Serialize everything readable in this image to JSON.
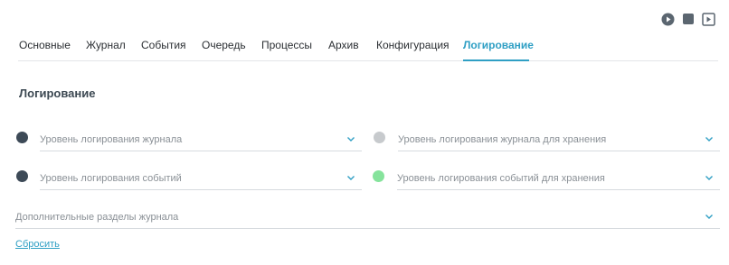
{
  "controls": {
    "play": "play-icon",
    "stop": "stop-icon",
    "step": "step-forward-icon"
  },
  "tabs": [
    {
      "label": "Основные"
    },
    {
      "label": "Журнал"
    },
    {
      "label": "События"
    },
    {
      "label": "Очередь"
    },
    {
      "label": "Процессы"
    },
    {
      "label": "Архив"
    },
    {
      "label": "Конфигурация"
    },
    {
      "label": "Логирование",
      "active": true
    }
  ],
  "section_title": "Логирование",
  "fields": {
    "journal_level": {
      "placeholder": "Уровень логирования журнала",
      "status_color": "#3d4a57"
    },
    "journal_storage_level": {
      "placeholder": "Уровень логирования журнала для хранения",
      "status_color": "#c7cacd"
    },
    "events_level": {
      "placeholder": "Уровень логирования событий",
      "status_color": "#3d4a57"
    },
    "events_storage_level": {
      "placeholder": "Уровень логирования событий для хранения",
      "status_color": "#86e39c"
    },
    "extra_sections": {
      "placeholder": "Дополнительные разделы журнала"
    }
  },
  "reset_label": "Сбросить",
  "colors": {
    "accent": "#2f9fc4",
    "icon": "#5b6670"
  }
}
